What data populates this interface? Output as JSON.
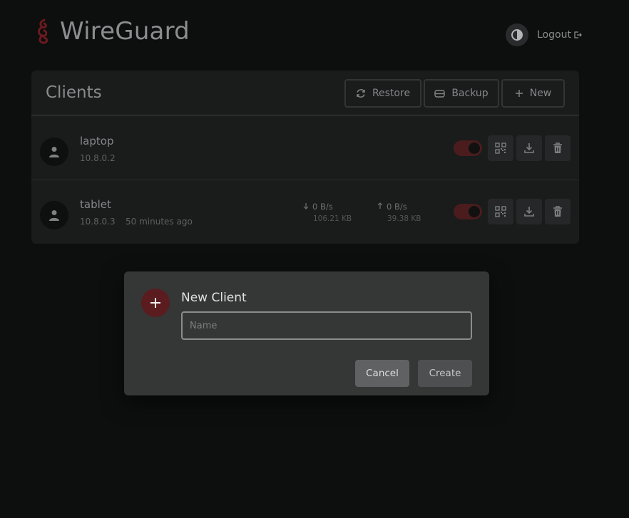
{
  "colors": {
    "accent": "#7a1f24",
    "background": "#0d0e0e",
    "card": "#1a1b1b",
    "modal": "#353636"
  },
  "header": {
    "title": "WireGuard",
    "logout_label": "Logout"
  },
  "clients_card": {
    "title": "Clients",
    "buttons": {
      "restore": "Restore",
      "backup": "Backup",
      "new": "New"
    }
  },
  "clients": [
    {
      "name": "laptop",
      "ip": "10.8.0.2",
      "enabled": true
    },
    {
      "name": "tablet",
      "ip": "10.8.0.3",
      "last_seen": "50 minutes ago",
      "enabled": true,
      "download_rate": "0 B/s",
      "download_total": "106.21 KB",
      "upload_rate": "0 B/s",
      "upload_total": "39.38 KB"
    }
  ],
  "modal": {
    "title": "New Client",
    "name_placeholder": "Name",
    "name_value": "",
    "cancel_label": "Cancel",
    "create_label": "Create"
  },
  "icons": [
    "wireguard-logo",
    "theme-toggle-icon",
    "logout-icon",
    "refresh-icon",
    "archive-icon",
    "plus-icon",
    "user-icon",
    "qr-code-icon",
    "download-icon",
    "trash-icon",
    "arrow-down-icon",
    "arrow-up-icon"
  ]
}
